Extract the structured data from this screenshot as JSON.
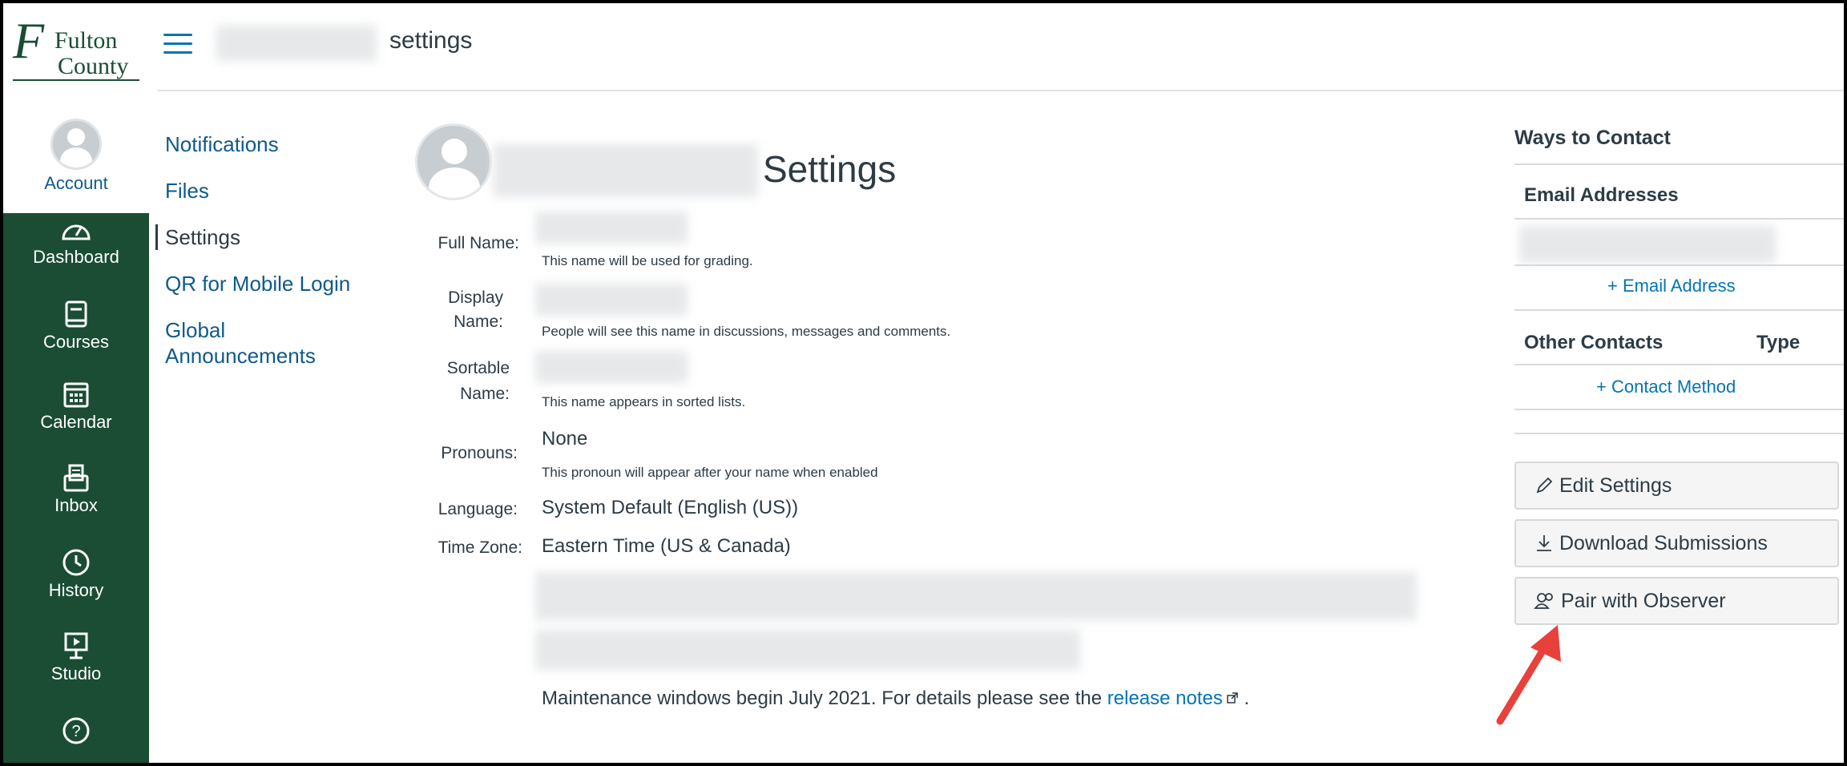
{
  "logo": {
    "text_line1": "Fulton",
    "text_line2": "County"
  },
  "global_nav": {
    "account": "Account",
    "dashboard": "Dashboard",
    "courses": "Courses",
    "calendar": "Calendar",
    "inbox": "Inbox",
    "history": "History",
    "studio": "Studio",
    "help_icon": "help-icon"
  },
  "header": {
    "breadcrumb": "settings"
  },
  "section_nav": {
    "items": [
      "Notifications",
      "Files",
      "Settings",
      "QR for Mobile Login",
      "Global Announcements"
    ]
  },
  "main": {
    "title": "Settings",
    "fields": {
      "full_name_label": "Full Name:",
      "full_name_help": "This name will be used for grading.",
      "display_name_label_1": "Display",
      "display_name_label_2": "Name:",
      "display_name_help": "People will see this name in discussions, messages and comments.",
      "sortable_name_label_1": "Sortable",
      "sortable_name_label_2": "Name:",
      "sortable_name_help": "This name appears in sorted lists.",
      "pronouns_label": "Pronouns:",
      "pronouns_value": "None",
      "pronouns_help": "This pronoun will appear after your name when enabled",
      "language_label": "Language:",
      "language_value": "System Default (English (US))",
      "timezone_label": "Time Zone:",
      "timezone_value": "Eastern Time (US & Canada)"
    },
    "maintenance_text": "Maintenance windows begin July 2021. For details please see the",
    "release_notes_link": "release notes",
    "maintenance_end": "."
  },
  "sidebar": {
    "ways_to_contact": "Ways to Contact",
    "email_addresses": "Email Addresses",
    "add_email": "+ Email Address",
    "other_contacts": "Other Contacts",
    "type": "Type",
    "add_contact": "+ Contact Method",
    "edit_settings": "Edit Settings",
    "download_submissions": "Download Submissions",
    "pair_with_observer": "Pair with Observer"
  },
  "colors": {
    "brand_dark": "#1a4d34",
    "link": "#0374b5",
    "annotation_arrow": "#e8403a"
  }
}
